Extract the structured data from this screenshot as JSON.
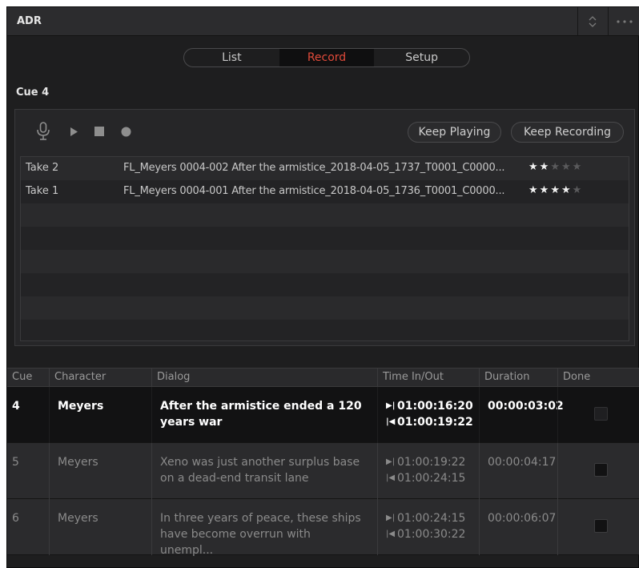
{
  "window": {
    "title": "ADR"
  },
  "tabs": [
    {
      "label": "List",
      "active": false
    },
    {
      "label": "Record",
      "active": true
    },
    {
      "label": "Setup",
      "active": false
    }
  ],
  "cue_title": "Cue 4",
  "toolbar": {
    "icons": [
      "microphone-icon",
      "play-icon",
      "stop-icon",
      "record-icon"
    ],
    "keep_playing": "Keep Playing",
    "keep_recording": "Keep Recording"
  },
  "takes": [
    {
      "name": "Take 2",
      "file": "FL_Meyers 0004-002 After the armistice_2018-04-05_1737_T0001_C0000...",
      "rating": 2,
      "max": 5
    },
    {
      "name": "Take 1",
      "file": "FL_Meyers 0004-001 After the armistice_2018-04-05_1736_T0001_C0000...",
      "rating": 4,
      "max": 5
    }
  ],
  "table": {
    "headers": [
      "Cue",
      "Character",
      "Dialog",
      "Time In/Out",
      "Duration",
      "Done"
    ],
    "rows": [
      {
        "cue": "4",
        "character": "Meyers",
        "dialog": "After the armistice ended a 120 years war",
        "time_in": "01:00:16:20",
        "time_out": "01:00:19:22",
        "duration": "00:00:03:02",
        "done": false,
        "selected": true
      },
      {
        "cue": "5",
        "character": "Meyers",
        "dialog": "Xeno was just another surplus base on a dead-end transit lane",
        "time_in": "01:00:19:22",
        "time_out": "01:00:24:15",
        "duration": "00:00:04:17",
        "done": false,
        "selected": false
      },
      {
        "cue": "6",
        "character": "Meyers",
        "dialog": "In three years of peace, these ships have become overrun with unempl...",
        "time_in": "01:00:24:15",
        "time_out": "01:00:30:22",
        "duration": "00:00:06:07",
        "done": false,
        "selected": false
      }
    ]
  },
  "colors": {
    "accent": "#e04a3a",
    "panel": "#1e1e1f",
    "selected_row": "#121213"
  }
}
